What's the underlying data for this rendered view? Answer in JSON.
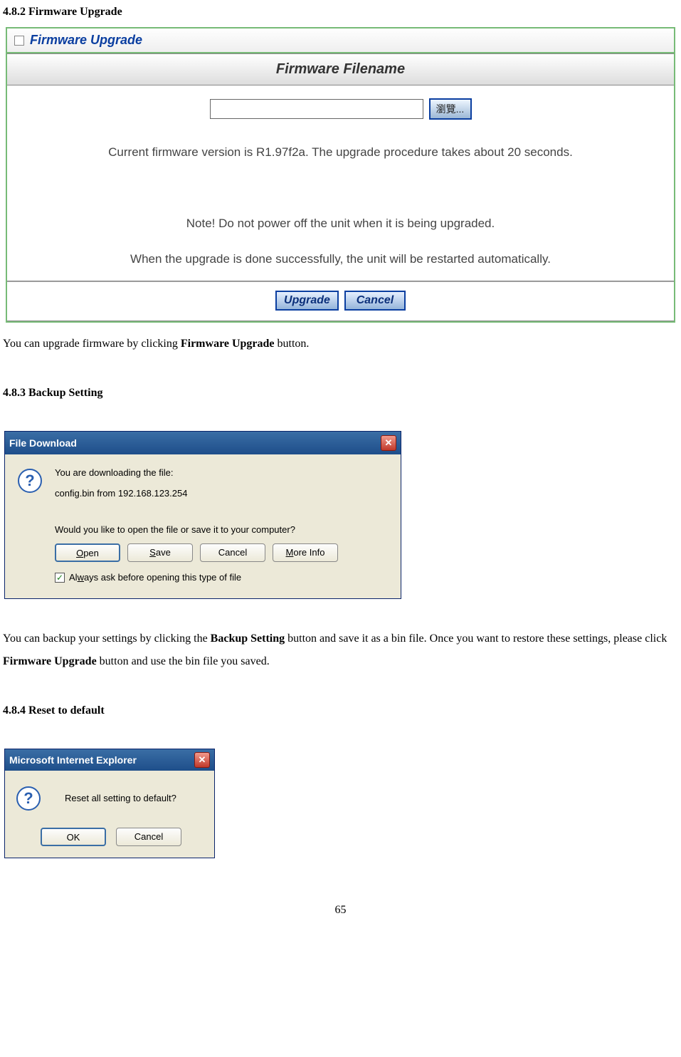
{
  "headings": {
    "h1": "4.8.2 Firmware Upgrade",
    "h2": "4.8.3 Backup Setting",
    "h3": "4.8.4 Reset to default"
  },
  "firmware_panel": {
    "header_title": "Firmware Upgrade",
    "section_label": "Firmware Filename",
    "browse_label": "瀏覽...",
    "version_text": "Current firmware version is R1.97f2a. The upgrade procedure takes about 20 seconds.",
    "note_text": "Note! Do not power off the unit when it is being upgraded.",
    "restart_text": "When the upgrade is done successfully, the unit will be restarted automatically.",
    "upgrade_btn": "Upgrade",
    "cancel_btn": "Cancel"
  },
  "paragraphs": {
    "para1_pre": "You can upgrade firmware by clicking ",
    "para1_bold": "Firmware Upgrade",
    "para1_post": " button.",
    "para2_pre": "You can backup your settings by clicking the ",
    "para2_bold1": "Backup Setting",
    "para2_mid": " button and save it as a bin file. Once you want to restore these settings, please click ",
    "para2_bold2": "Firmware Upgrade",
    "para2_post": " button and use the bin file you saved."
  },
  "file_download": {
    "title": "File Download",
    "line1": "You are downloading the file:",
    "line2": "config.bin from 192.168.123.254",
    "line3": "Would you like to open the file or save it to your computer?",
    "open": "Open",
    "save": "Save",
    "cancel": "Cancel",
    "more": "More Info",
    "always": "Always ask before opening this type of file"
  },
  "ie_dialog": {
    "title": "Microsoft Internet Explorer",
    "message": "Reset all setting to default?",
    "ok": "OK",
    "cancel": "Cancel"
  },
  "page_number": "65"
}
